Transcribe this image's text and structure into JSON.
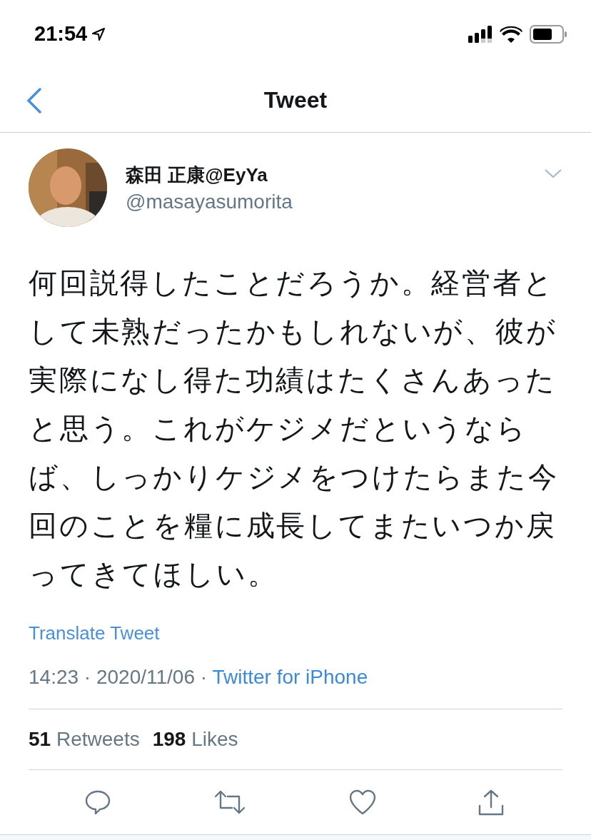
{
  "status_bar": {
    "time": "21:54"
  },
  "nav": {
    "title": "Tweet"
  },
  "tweet": {
    "author": {
      "name": "森田 正康@EyYa",
      "handle": "@masayasumorita"
    },
    "text": "何回説得したことだろうか。経営者として未熟だったかもしれないが、彼が実際になし得た功績はたくさんあったと思う。これがケジメだというならば、しっかりケジメをつけたらまた今回のことを糧に成長してまたいつか戻ってきてほしい。",
    "translate": "Translate Tweet",
    "timestamp": "14:23 · 2020/11/06 · ",
    "source": "Twitter for iPhone",
    "stats": [
      {
        "count": "51",
        "label": "Retweets"
      },
      {
        "count": "198",
        "label": "Likes"
      }
    ],
    "actions": [
      {
        "kind": "reply"
      },
      {
        "kind": "retweet"
      },
      {
        "kind": "like"
      },
      {
        "kind": "share"
      }
    ]
  }
}
